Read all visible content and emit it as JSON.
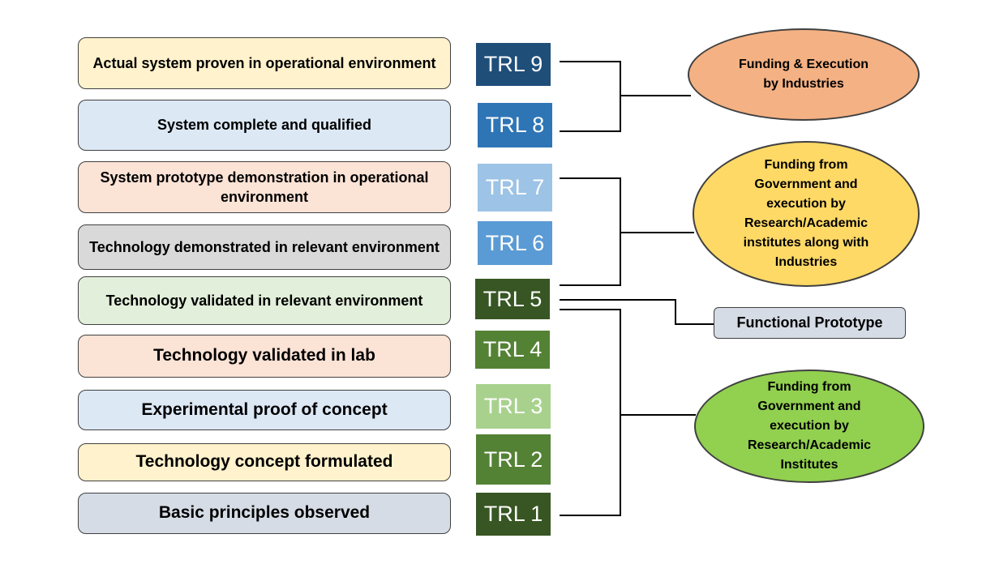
{
  "levels": [
    {
      "text": "Actual system proven in operational environment",
      "trl": "TRL 9",
      "fill": "#fff2cc",
      "trl_color": "#1f4e79"
    },
    {
      "text": "System complete and qualified",
      "trl": "TRL 8",
      "fill": "#dde8f5",
      "trl_color": "#2e75b6"
    },
    {
      "text": "System prototype demonstration in operational environment",
      "trl": "TRL 7",
      "fill": "#fbe3d6",
      "trl_color": "#9dc3e6"
    },
    {
      "text": "Technology demonstrated in relevant environment",
      "trl": "TRL 6",
      "fill": "#d9d9d9",
      "trl_color": "#5b9bd5"
    },
    {
      "text": "Technology validated in relevant environment",
      "trl": "TRL 5",
      "fill": "#e2efda",
      "trl_color": "#375623"
    },
    {
      "text": "Technology validated in lab",
      "trl": "TRL 4",
      "fill": "#fbe3d6",
      "trl_color": "#548235"
    },
    {
      "text": "Experimental proof of concept",
      "trl": "TRL 3",
      "fill": "#dde8f5",
      "trl_color": "#a9d18e"
    },
    {
      "text": "Technology concept formulated",
      "trl": "TRL 2",
      "fill": "#fff2cc",
      "trl_color": "#548235"
    },
    {
      "text": "Basic principles observed",
      "trl": "TRL 1",
      "fill": "#d6dce5",
      "trl_color": "#375623"
    }
  ],
  "groups": [
    {
      "text": "Funding & Execution by Industries",
      "fill": "#f4b183"
    },
    {
      "text": "Funding from Government and execution by Research/Academic institutes along with Industries",
      "fill": "#ffd966"
    },
    {
      "text": "Funding from Government and execution by Research/Academic Institutes",
      "fill": "#92d050"
    }
  ],
  "milestone": "Functional Prototype"
}
